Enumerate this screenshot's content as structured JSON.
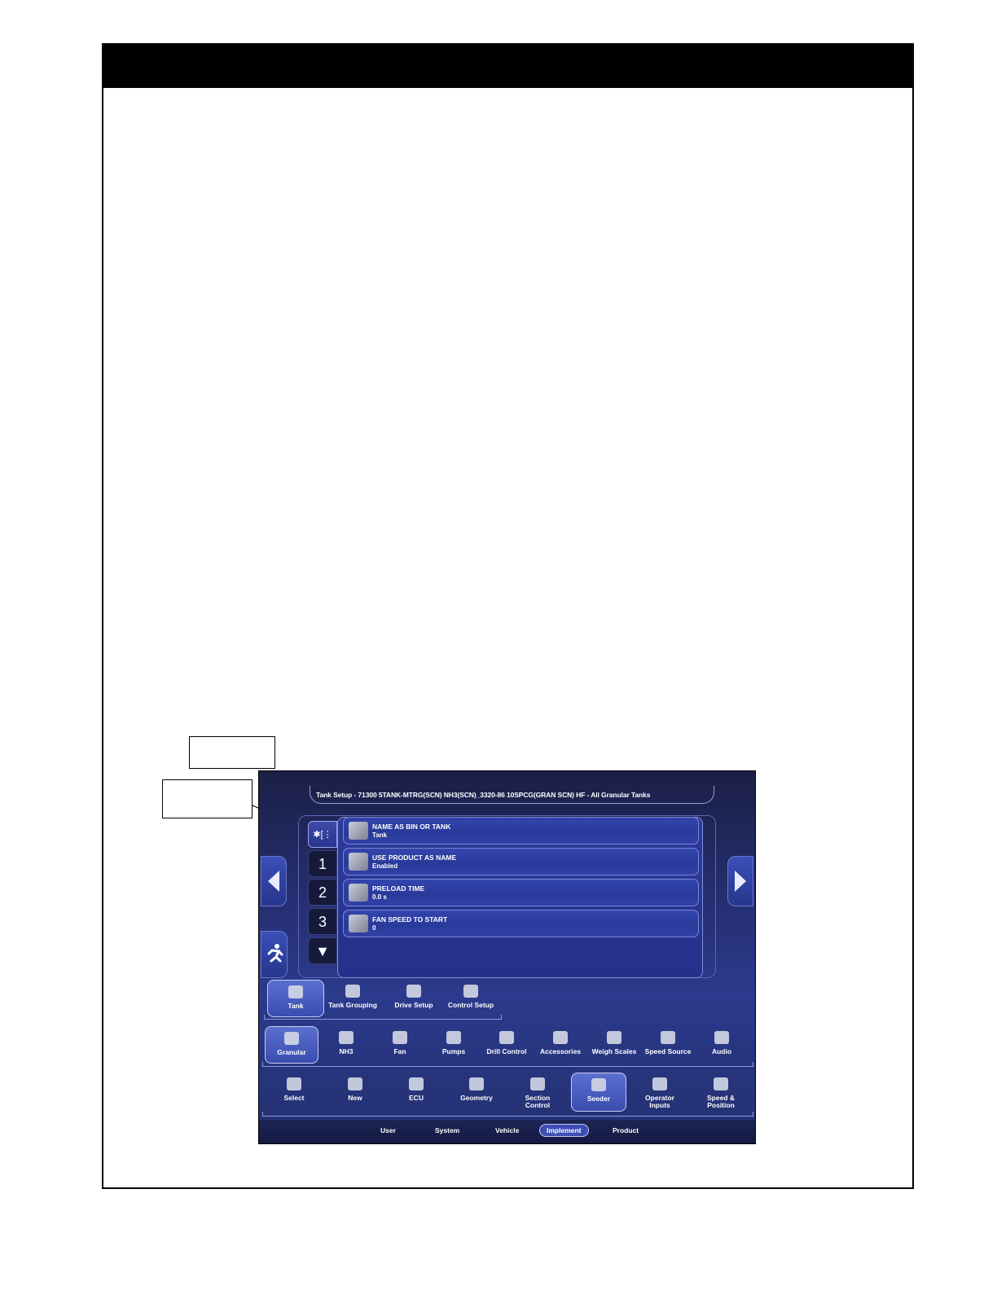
{
  "screen": {
    "title": "Tank Setup - 71300 5TANK-MTRG(SCN) NH3(SCN)_3320-86 10SPCG(GRAN SCN) HF - All Granular Tanks",
    "vertical_tabs": [
      {
        "label": "✱[⋮",
        "selected": true
      },
      {
        "label": "1",
        "selected": false
      },
      {
        "label": "2",
        "selected": false
      },
      {
        "label": "3",
        "selected": false
      },
      {
        "label": "▼",
        "selected": false
      }
    ],
    "rows": [
      {
        "label": "NAME AS BIN OR TANK",
        "value": "Tank",
        "icon": "bin-icon"
      },
      {
        "label": "USE PRODUCT AS NAME",
        "value": "Enabled",
        "icon": "product-name-icon"
      },
      {
        "label": "PRELOAD TIME",
        "value": "0.0 s",
        "icon": "preload-timer-icon"
      },
      {
        "label": "FAN SPEED TO START",
        "value": "0",
        "icon": "fan-speed-icon"
      }
    ],
    "tank_menu": [
      {
        "label": "Tank",
        "selected": true
      },
      {
        "label": "Tank Grouping",
        "selected": false
      },
      {
        "label": "Drive Setup",
        "selected": false
      },
      {
        "label": "Control Setup",
        "selected": false
      }
    ],
    "seeder_menu": [
      {
        "label": "Granular",
        "selected": true
      },
      {
        "label": "NH3",
        "selected": false
      },
      {
        "label": "Fan",
        "selected": false
      },
      {
        "label": "Pumps",
        "selected": false
      },
      {
        "label": "Drill Control",
        "selected": false
      },
      {
        "label": "Accessories",
        "selected": false
      },
      {
        "label": "Weigh Scales",
        "selected": false
      },
      {
        "label": "Speed Source",
        "selected": false
      },
      {
        "label": "Audio",
        "selected": false
      }
    ],
    "implement_menu": [
      {
        "label": "Select",
        "selected": false
      },
      {
        "label": "New",
        "selected": false
      },
      {
        "label": "ECU",
        "selected": false
      },
      {
        "label": "Geometry",
        "selected": false
      },
      {
        "label": "Section\nControl",
        "selected": false
      },
      {
        "label": "Seeder",
        "selected": true
      },
      {
        "label": "Operator\nInputs",
        "selected": false
      },
      {
        "label": "Speed &\nPosition",
        "selected": false
      }
    ],
    "main_tabs": [
      {
        "label": "User",
        "selected": false
      },
      {
        "label": "System",
        "selected": false
      },
      {
        "label": "Vehicle",
        "selected": false
      },
      {
        "label": "Implement",
        "selected": true
      },
      {
        "label": "Product",
        "selected": false
      }
    ],
    "colors": {
      "accent": "#2b3a8c",
      "selected": "#5b6fcf",
      "bg_dark": "#1b2046"
    }
  }
}
